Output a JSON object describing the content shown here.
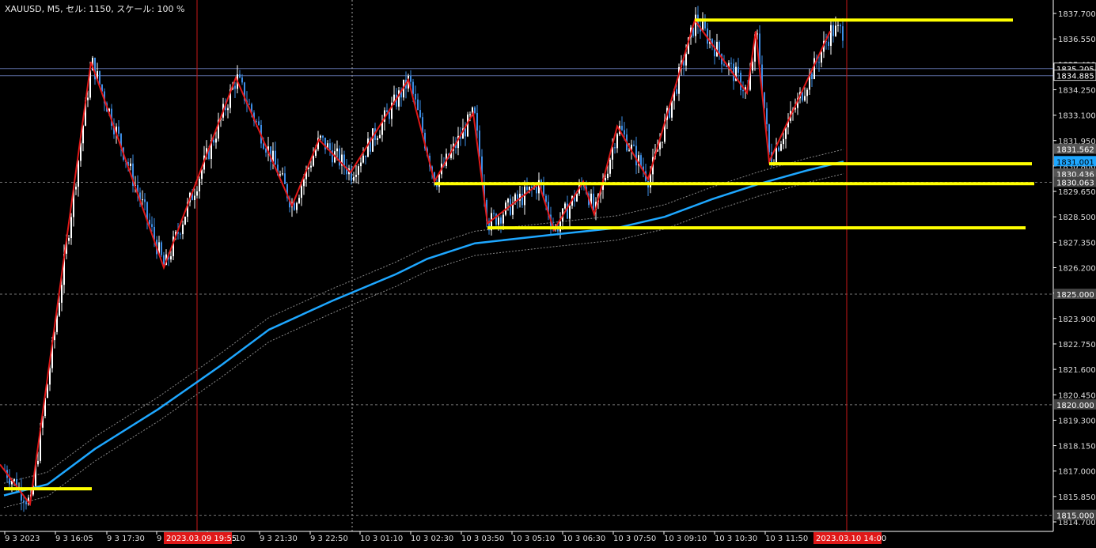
{
  "header": {
    "symbol": "XAUUSD",
    "timeframe": "M5",
    "cell_label": "セル",
    "cell_value": "1150",
    "scale_label": "スケール",
    "scale_value": "100 %",
    "text": "XAUUSD, M5, セル: 1150, スケール: 100 %"
  },
  "colors": {
    "background": "#000000",
    "candle_up": "#ffffff",
    "candle_down": "#3d8ee6",
    "zigzag": "#e01818",
    "support_lines": "#ffff00",
    "moving_average": "#1ea7ff",
    "band": "#888888",
    "axis": "#ffffff",
    "period_separator": "#c81818"
  },
  "chart_data": {
    "type": "candlestick",
    "title": "",
    "ylim": [
      1814.7,
      1838.2
    ],
    "y_ticks": [
      "1837.700",
      "1836.550",
      "1835.400",
      "1834.250",
      "1833.100",
      "1831.950",
      "1830.800",
      "1829.650",
      "1828.500",
      "1827.350",
      "1826.200",
      "1825.050",
      "1823.900",
      "1822.750",
      "1821.600",
      "1820.450",
      "1819.300",
      "1818.150",
      "1817.000",
      "1815.850",
      "1814.700"
    ],
    "x_ticks": [
      "9 3 2023",
      "9 3 16:05",
      "9 3 17:30",
      "9",
      "9 3 20:10",
      "9 3 21:30",
      "9 3 22:50",
      "10 3 01:10",
      "10 3 02:30",
      "10 3 03:50",
      "10 3 05:10",
      "10 3 06:30",
      "10 3 07:50",
      "10 3 09:10",
      "10 3 10:30",
      "10 3 11:50"
    ],
    "price_labels": [
      {
        "value": "1835.205",
        "kind": "ask"
      },
      {
        "value": "1834.885",
        "kind": "bid"
      },
      {
        "value": "1831.562",
        "kind": "band"
      },
      {
        "value": "1831.001",
        "kind": "ma",
        "highlight": true
      },
      {
        "value": "1830.436",
        "kind": "band"
      },
      {
        "value": "1830.063",
        "kind": "level"
      },
      {
        "value": "1825.000",
        "kind": "level"
      },
      {
        "value": "1820.000",
        "kind": "level"
      },
      {
        "value": "1815.000",
        "kind": "level"
      }
    ],
    "time_labels": [
      {
        "value": "2023.03.09 19:55",
        "kind": "separator"
      },
      {
        "value": "2023.03.10 14:00",
        "kind": "separator"
      }
    ],
    "zigzag": [
      [
        0,
        1817.3
      ],
      [
        38,
        1815.5
      ],
      [
        115,
        1835.5
      ],
      [
        207,
        1826.2
      ],
      [
        298,
        1834.8
      ],
      [
        369,
        1829.0
      ],
      [
        403,
        1832.0
      ],
      [
        443,
        1830.5
      ],
      [
        516,
        1834.7
      ],
      [
        549,
        1830.1
      ],
      [
        598,
        1833.2
      ],
      [
        616,
        1828.2
      ],
      [
        681,
        1830.0
      ],
      [
        700,
        1827.9
      ],
      [
        737,
        1830.1
      ],
      [
        751,
        1828.6
      ],
      [
        780,
        1832.6
      ],
      [
        819,
        1830.2
      ],
      [
        878,
        1837.4
      ],
      [
        944,
        1834.1
      ],
      [
        955,
        1836.9
      ],
      [
        972,
        1831.0
      ],
      [
        1049,
        1836.9
      ]
    ],
    "support_levels": [
      {
        "price": 1837.4,
        "x1": 878,
        "x2": 1280
      },
      {
        "price": 1830.9,
        "x1": 972,
        "x2": 1304
      },
      {
        "price": 1830.0,
        "x1": 549,
        "x2": 1307
      },
      {
        "price": 1828.0,
        "x1": 616,
        "x2": 1296
      },
      {
        "price": 1816.2,
        "x1": 5,
        "x2": 116
      }
    ],
    "moving_average": [
      [
        5,
        1815.9
      ],
      [
        60,
        1816.4
      ],
      [
        120,
        1818.0
      ],
      [
        200,
        1819.8
      ],
      [
        280,
        1821.8
      ],
      [
        340,
        1823.4
      ],
      [
        420,
        1824.7
      ],
      [
        500,
        1825.9
      ],
      [
        540,
        1826.6
      ],
      [
        600,
        1827.3
      ],
      [
        700,
        1827.7
      ],
      [
        780,
        1828.0
      ],
      [
        840,
        1828.5
      ],
      [
        900,
        1829.3
      ],
      [
        960,
        1830.0
      ],
      [
        1020,
        1830.6
      ],
      [
        1066,
        1831.0
      ]
    ],
    "band_width": 0.55,
    "price_lines": [
      1835.205,
      1834.885
    ],
    "dashed_levels": [
      1830.063,
      1825.0,
      1820.0,
      1815.0
    ],
    "separators_x": [
      249,
      1070
    ],
    "dotted_vertical_x": [
      445
    ]
  }
}
